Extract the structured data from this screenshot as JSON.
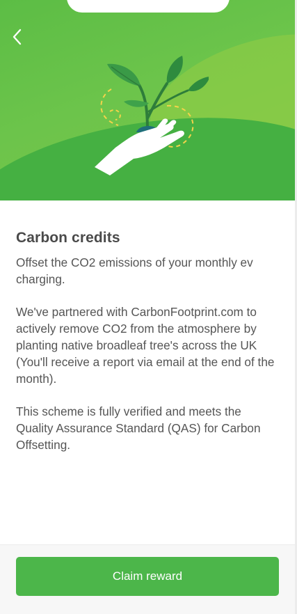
{
  "header": {
    "back_icon": "chevron-left-icon"
  },
  "hero": {
    "illustration": "hand-holding-seedling-icon",
    "colors": {
      "background": "#6cc44b",
      "leaf_dark": "#2e8b3e",
      "leaf_light": "#3ea24a",
      "dashes": "#f3d34a"
    }
  },
  "content": {
    "title": "Carbon credits",
    "paragraphs": [
      "Offset the CO2 emissions of your monthly ev charging.",
      "We've partnered with CarbonFootprint.com to actively remove CO2 from the atmosphere by planting native broadleaf tree's across the UK (You'll receive a report via email at the end of the month).",
      "This scheme is fully verified and meets the Quality Assurance Standard (QAS) for Carbon Offsetting."
    ]
  },
  "footer": {
    "claim_label": "Claim reward",
    "accent": "#4cb64a"
  }
}
